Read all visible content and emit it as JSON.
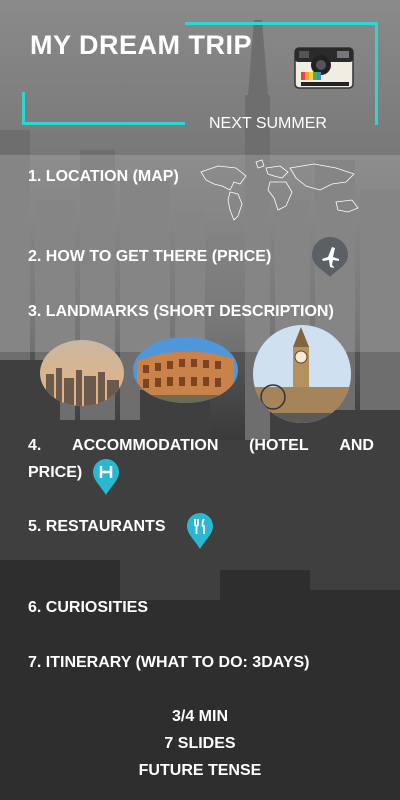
{
  "header": {
    "title": "MY DREAM TRIP",
    "subtitle": "NEXT SUMMER",
    "accent_color": "#2fd6cf"
  },
  "items": [
    {
      "label": "1.  LOCATION (MAP)",
      "icon": "world-map-icon"
    },
    {
      "label": "2. HOW TO GET THERE  (PRICE)",
      "icon": "airplane-pin-icon"
    },
    {
      "label": "3. LANDMARKS (SHORT DESCRIPTION)",
      "photos": [
        "city-skyline-photo",
        "colosseum-photo",
        "big-ben-photo"
      ]
    },
    {
      "label_words": [
        "4.",
        "ACCOMMODATION",
        "(HOTEL",
        "AND"
      ],
      "label_line2": "PRICE)",
      "icon": "hotel-pin-icon"
    },
    {
      "label": "5. RESTAURANTS",
      "icon": "restaurant-pin-icon"
    },
    {
      "label": "6. CURIOSITIES"
    },
    {
      "label": "7. ITINERARY (WHAT TO DO: 3DAYS)"
    }
  ],
  "footer": [
    "3/4 MIN",
    "7 SLIDES",
    "FUTURE TENSE"
  ]
}
